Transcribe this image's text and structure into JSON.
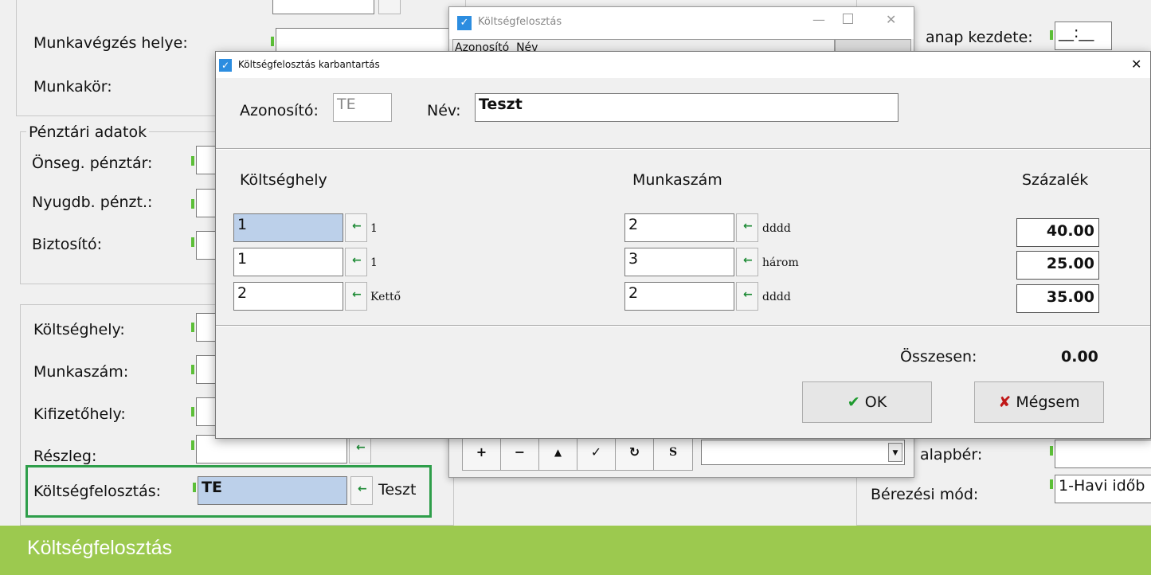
{
  "background_form": {
    "munkavegzes_helye_label": "Munkavégzés helye:",
    "munkakor_label": "Munkakör:",
    "penztari_group_label": "Pénztári adatok",
    "onseg_penztar_label": "Önseg. pénztár:",
    "nyugdb_penzt_label": "Nyugdb. pénzt.:",
    "biztosito_label": "Biztosító:",
    "koltseghely_label": "Költséghely:",
    "munkaszam_label": "Munkaszám:",
    "kifizetohely_label": "Kifizetőhely:",
    "reszleg_label": "Részleg:",
    "koltsegfelosztas_label": "Költségfelosztás:",
    "koltsegfelosztas_value": "TE",
    "koltsegfelosztas_descr": "Teszt",
    "napkezdete_label": "anap kezdete:",
    "napkezdete_value": "__:__",
    "alapber_label": "alapbér:",
    "berezesi_mod_label": "Bérezési mód:",
    "berezesi_mod_value": "1-Havi időb"
  },
  "list_window": {
    "title": "Költségfelosztás",
    "header_partial": "Azonosító  Név",
    "toolbar": {
      "add": "+",
      "remove": "−",
      "up": "▲",
      "confirm": "✓",
      "refresh": "↻",
      "s": "S"
    }
  },
  "dialog": {
    "title": "Költségfelosztás karbantartás",
    "azonosito_label": "Azonosító:",
    "azonosito_value": "TE",
    "nev_label": "Név:",
    "nev_value": "Teszt",
    "col_koltseghely": "Költséghely",
    "col_munkaszam": "Munkaszám",
    "col_szazalek": "Százalék",
    "rows": [
      {
        "koltseghely": "1",
        "koltseghely_descr": "1",
        "munkaszam": "2",
        "munkaszam_descr": "dddd",
        "szazalek": "40.00"
      },
      {
        "koltseghely": "1",
        "koltseghely_descr": "1",
        "munkaszam": "3",
        "munkaszam_descr": "három",
        "szazalek": "25.00"
      },
      {
        "koltseghely": "2",
        "koltseghely_descr": "Kettő",
        "munkaszam": "2",
        "munkaszam_descr": "dddd",
        "szazalek": "35.00"
      }
    ],
    "osszesen_label": "Összesen:",
    "osszesen_value": "0.00",
    "ok_label": "OK",
    "cancel_label": "Mégsem"
  },
  "caption": "Költségfelosztás",
  "colors": {
    "caption_bar": "#9cc94f",
    "highlight_border": "#2e9e4a",
    "selection": "#bcd0ea",
    "accent_blue": "#2c8de0"
  }
}
